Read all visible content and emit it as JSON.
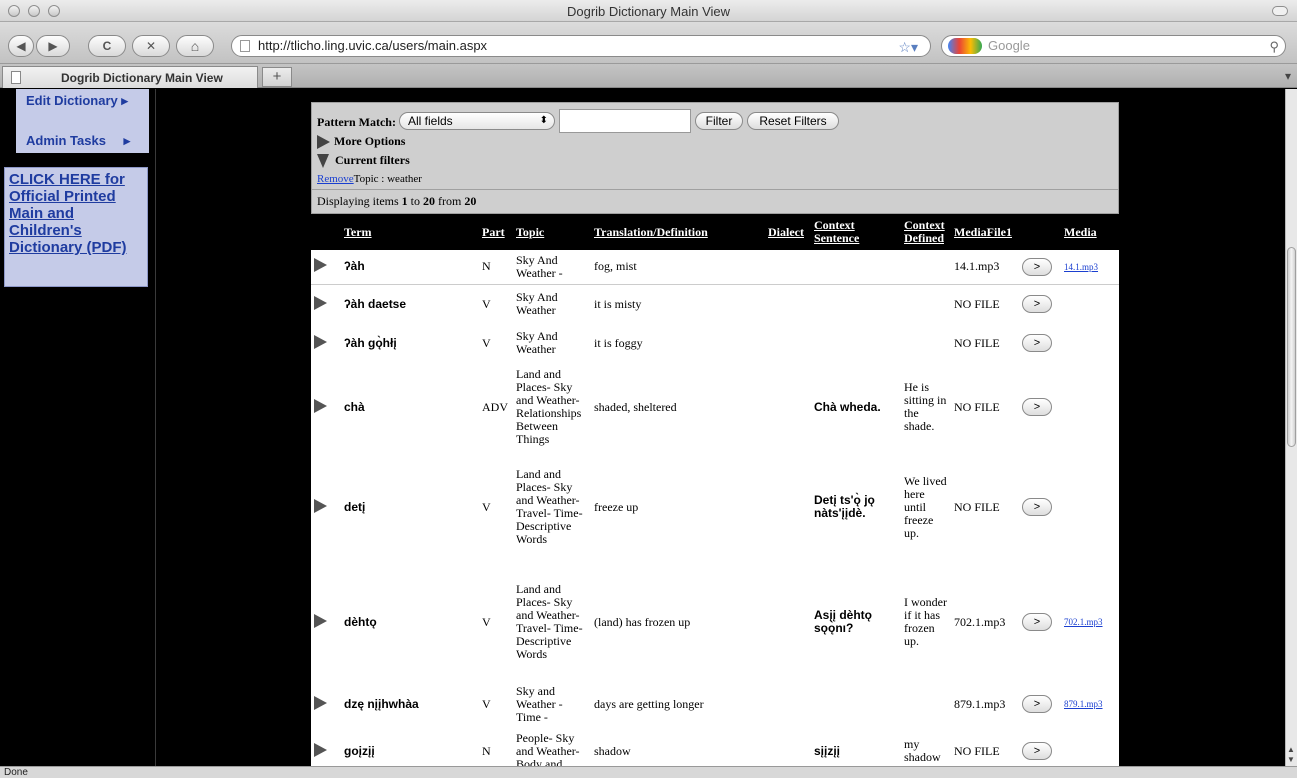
{
  "window": {
    "title": "Dogrib Dictionary Main View"
  },
  "toolbar": {
    "back": "◀",
    "forward": "▶",
    "reload": "C",
    "stop": "✕",
    "home": "⌂",
    "url": "http://tlicho.ling.uvic.ca/users/main.aspx",
    "search_placeholder": "Google"
  },
  "tabs": [
    {
      "label": "Dogrib Dictionary Main View"
    }
  ],
  "new_tab": "+",
  "sidebar": {
    "edit": "Edit Dictionary ▸",
    "admin": "Admin Tasks",
    "admin_arrow": "▸",
    "link": "CLICK HERE for Official Printed Main and Children's Dictionary (PDF)"
  },
  "filters": {
    "pattern_label": "Pattern Match:",
    "pattern_value": "All fields",
    "filter_btn": "Filter",
    "reset_btn": "Reset Filters",
    "more_options": "More Options",
    "current_filters": "Current filters",
    "remove_link": "Remove",
    "current_filter_text": "Topic : weather"
  },
  "displaying": {
    "prefix": "Displaying items ",
    "from": "1",
    "to_word": " to ",
    "to": "20",
    "from_word": " from ",
    "total": "20"
  },
  "table": {
    "headers": {
      "term": "Term",
      "part": "Part",
      "topic": "Topic",
      "translation": "Translation/Definition",
      "dialect": "Dialect",
      "context_sentence": "Context Sentence",
      "context_defined": "Context Defined",
      "mediafile": "MediaFile1",
      "media": "Media"
    },
    "play_label": ">",
    "rows": [
      {
        "term": "ʔàh",
        "part": "N",
        "topic": "Sky And Weather -",
        "translation": "fog, mist",
        "dialect": "",
        "context_sentence": "",
        "context_defined": "",
        "mediafile": "14.1.mp3",
        "media": "14.1.mp3"
      },
      {
        "term": "ʔàh daetse",
        "part": "V",
        "topic": "Sky And Weather",
        "translation": "it is misty",
        "dialect": "",
        "context_sentence": "",
        "context_defined": "",
        "mediafile": "NO FILE",
        "media": ""
      },
      {
        "term": "ʔàh gǫ̀hłį",
        "part": "V",
        "topic": "Sky And Weather",
        "translation": "it is foggy",
        "dialect": "",
        "context_sentence": "",
        "context_defined": "",
        "mediafile": "NO FILE",
        "media": ""
      },
      {
        "term": "chà",
        "part": "ADV",
        "topic": "Land and Places- Sky and Weather- Relationships Between Things",
        "translation": "shaded, sheltered",
        "dialect": "",
        "context_sentence": "Chà wheda.",
        "context_defined": "He is sitting in the shade.",
        "mediafile": "NO FILE",
        "media": ""
      },
      {
        "term": "detį",
        "part": "V",
        "topic": "Land and Places- Sky and Weather- Travel- Time- Descriptive Words",
        "translation": "freeze up",
        "dialect": "",
        "context_sentence": "Detį ts'ǫ̀ jǫ nàts'įįdè.",
        "context_defined": "We lived here until freeze up.",
        "mediafile": "NO FILE",
        "media": ""
      },
      {
        "term": "dèhtǫ",
        "part": "V",
        "topic": "Land and Places- Sky and Weather- Travel- Time- Descriptive Words",
        "translation": "(land) has frozen up",
        "dialect": "",
        "context_sentence": "Asįį dèhtǫ sǫǫ̀nı?",
        "context_defined": "I wonder if it has frozen up.",
        "mediafile": "702.1.mp3",
        "media": "702.1.mp3"
      },
      {
        "term": "dzę nįįhwhàa",
        "part": "V",
        "topic": "Sky and Weather - Time -",
        "translation": "days are getting longer",
        "dialect": "",
        "context_sentence": "",
        "context_defined": "",
        "mediafile": "879.1.mp3",
        "media": "879.1.mp3"
      },
      {
        "term": "goįzįį",
        "part": "N",
        "topic": "People- Sky and Weather- Body and",
        "translation": "shadow",
        "dialect": "",
        "context_sentence": "sįįzįį",
        "context_defined": "my shadow",
        "mediafile": "NO FILE",
        "media": ""
      }
    ]
  },
  "status": {
    "text": "Done"
  }
}
